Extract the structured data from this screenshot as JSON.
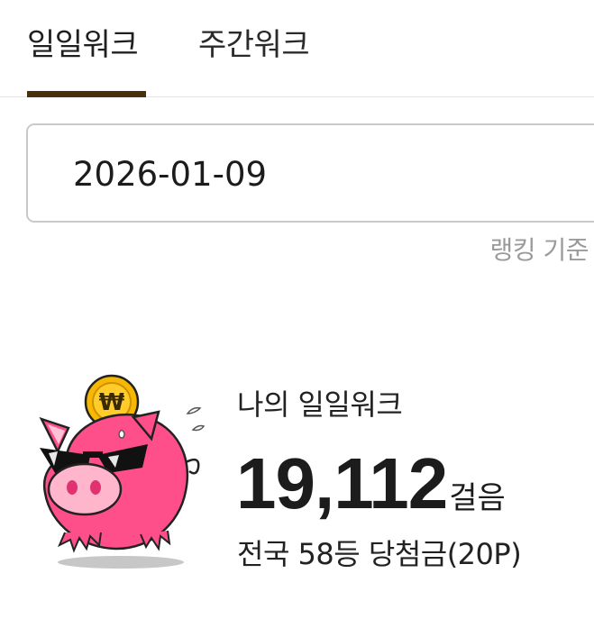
{
  "tabs": {
    "daily": "일일워크",
    "weekly": "주간워크"
  },
  "date_selector": {
    "value": "2026-01-09"
  },
  "ranking_basis": "랭킹 기준",
  "summary": {
    "title": "나의 일일워크",
    "steps": "19,112",
    "steps_unit": "걸음",
    "rank_line": "전국 58등 당첨금(20P)"
  },
  "illustration": {
    "name": "pig-with-coin-icon",
    "coin_symbol": "₩"
  },
  "colors": {
    "tab_indicator": "#4a2f0c",
    "pig": "#ff4f8b",
    "coin": "#f5b400"
  }
}
